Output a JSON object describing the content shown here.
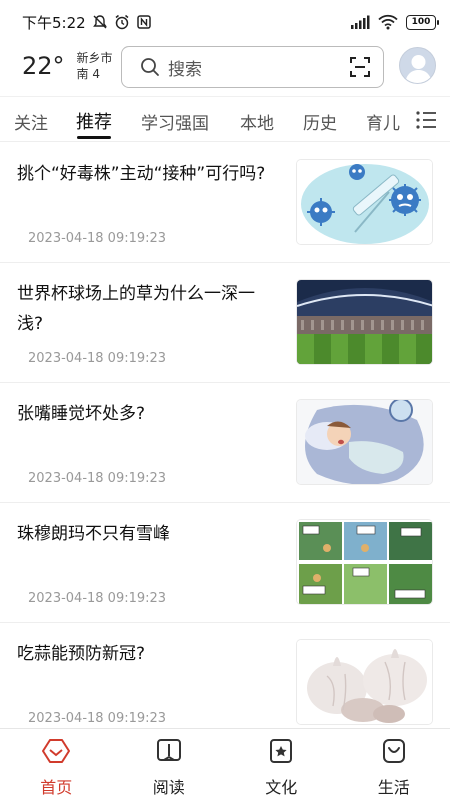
{
  "status_bar": {
    "time": "下午5:22",
    "battery": "100"
  },
  "header": {
    "temperature": "22°",
    "city": "新乡市",
    "wind": "南 4",
    "search_placeholder": "搜索"
  },
  "tabs": [
    {
      "label": "关注"
    },
    {
      "label": "推荐"
    },
    {
      "label": "学习强国"
    },
    {
      "label": "本地"
    },
    {
      "label": "历史"
    },
    {
      "label": "育儿"
    }
  ],
  "feed": [
    {
      "title": "挑个“好毒株”主动“接种”可行吗?",
      "date": "2023-04-18 09:19:23",
      "thumb": "virus-illustration"
    },
    {
      "title": "世界杯球场上的草为什么一深一浅?",
      "date": "2023-04-18 09:19:23",
      "thumb": "stadium-photo"
    },
    {
      "title": "张嘴睡觉坏处多?",
      "date": "2023-04-18 09:19:23",
      "thumb": "sleeping-child-illustration"
    },
    {
      "title": "珠穆朗玛不只有雪峰",
      "date": "2023-04-18 09:19:23",
      "thumb": "comic-strip"
    },
    {
      "title": "吃蒜能预防新冠?",
      "date": "2023-04-18 09:19:23",
      "thumb": "garlic-photo"
    }
  ],
  "bottom_nav": [
    {
      "label": "首页",
      "icon": "home-icon",
      "active": true
    },
    {
      "label": "阅读",
      "icon": "book-icon",
      "active": false
    },
    {
      "label": "文化",
      "icon": "culture-icon",
      "active": false
    },
    {
      "label": "生活",
      "icon": "life-icon",
      "active": false
    }
  ],
  "colors": {
    "accent": "#d13b2c",
    "text": "#111111",
    "muted": "#999999"
  }
}
